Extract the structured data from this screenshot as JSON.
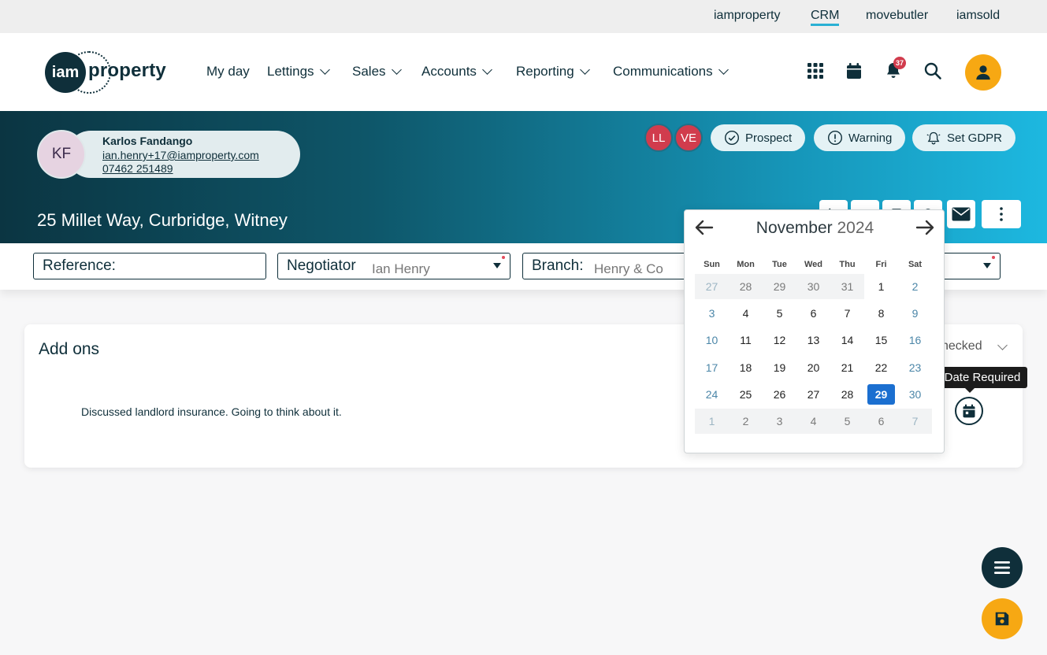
{
  "top_links": [
    {
      "label": "iamproperty",
      "active": false
    },
    {
      "label": "CRM",
      "active": true
    },
    {
      "label": "movebutler",
      "active": false
    },
    {
      "label": "iamsold",
      "active": false
    }
  ],
  "logo": {
    "circle": "iam",
    "text": "property"
  },
  "nav": [
    {
      "label": "My day",
      "dropdown": false
    },
    {
      "label": "Lettings",
      "dropdown": true
    },
    {
      "label": "Sales",
      "dropdown": true
    },
    {
      "label": "Accounts",
      "dropdown": true
    },
    {
      "label": "Reporting",
      "dropdown": true
    },
    {
      "label": "Communications",
      "dropdown": true
    }
  ],
  "header_icons": {
    "apps": "grid-icon",
    "calendar": "calendar-icon",
    "bell": "bell-icon",
    "search": "search-icon",
    "user": "user-icon",
    "notification_count": "37"
  },
  "contact": {
    "initials": "KF",
    "name": "Karlos Fandango",
    "email": "ian.henry+17@iamproperty.com",
    "phone": "07462 251489"
  },
  "badges": [
    "LL",
    "VE"
  ],
  "status_pills": {
    "prospect": "Prospect",
    "warning": "Warning",
    "gdpr": "Set GDPR"
  },
  "address": "25 Millet Way, Curbridge, Witney",
  "fields": {
    "reference": {
      "label": "Reference:",
      "value": ""
    },
    "negotiator": {
      "label": "Negotiator",
      "value": "Ian Henry"
    },
    "branch": {
      "label": "Branch:",
      "value": "Henry & Co"
    }
  },
  "card": {
    "title": "Add ons",
    "note": "Discussed landlord insurance. Going to think about it.",
    "checked_label": "hecked",
    "tooltip": "Date Required"
  },
  "datepicker": {
    "month": "November",
    "year": "2024",
    "weekdays": [
      "Sun",
      "Mon",
      "Tue",
      "Wed",
      "Thu",
      "Fri",
      "Sat"
    ],
    "weeks": [
      [
        "27",
        "28",
        "29",
        "30",
        "31",
        "1",
        "2"
      ],
      [
        "3",
        "4",
        "5",
        "6",
        "7",
        "8",
        "9"
      ],
      [
        "10",
        "11",
        "12",
        "13",
        "14",
        "15",
        "16"
      ],
      [
        "17",
        "18",
        "19",
        "20",
        "21",
        "22",
        "23"
      ],
      [
        "24",
        "25",
        "26",
        "27",
        "28",
        "29",
        "30"
      ],
      [
        "1",
        "2",
        "3",
        "4",
        "5",
        "6",
        "7"
      ]
    ],
    "selected": "29"
  },
  "colors": {
    "primary": "#0f2f3a",
    "accent": "#f7a813",
    "danger": "#d13c4d",
    "selected": "#1b6fd0",
    "link_active": "#2ab0d4"
  }
}
